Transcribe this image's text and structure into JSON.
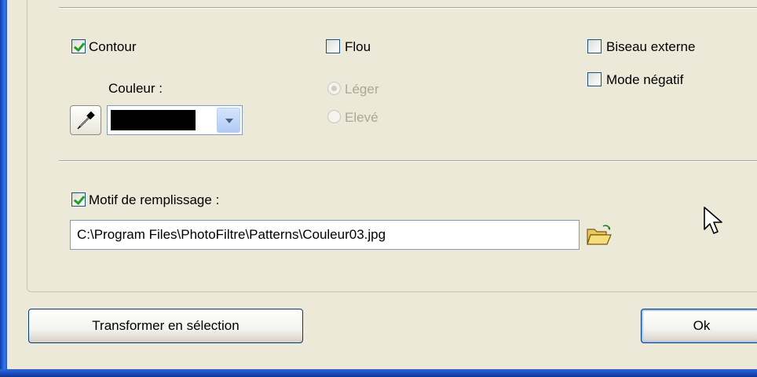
{
  "options": {
    "contour": {
      "label": "Contour",
      "checked": true
    },
    "couleur_label": "Couleur :",
    "color_value": "#000000",
    "flou": {
      "label": "Flou",
      "checked": false
    },
    "intensity": [
      {
        "label": "Léger",
        "selected": true,
        "disabled": true
      },
      {
        "label": "Elevé",
        "selected": false,
        "disabled": true
      }
    ],
    "biseau": {
      "label": "Biseau externe",
      "checked": false
    },
    "negatif": {
      "label": "Mode négatif",
      "checked": false
    }
  },
  "pattern": {
    "label": "Motif de remplissage :",
    "checked": true,
    "path": "C:\\Program Files\\PhotoFiltre\\Patterns\\Couleur03.jpg"
  },
  "buttons": {
    "transform": "Transformer en sélection",
    "ok": "Ok"
  },
  "icons": {
    "picker": "eyedropper-icon",
    "browse": "folder-open-icon",
    "cursor": "mouse-pointer-icon"
  }
}
